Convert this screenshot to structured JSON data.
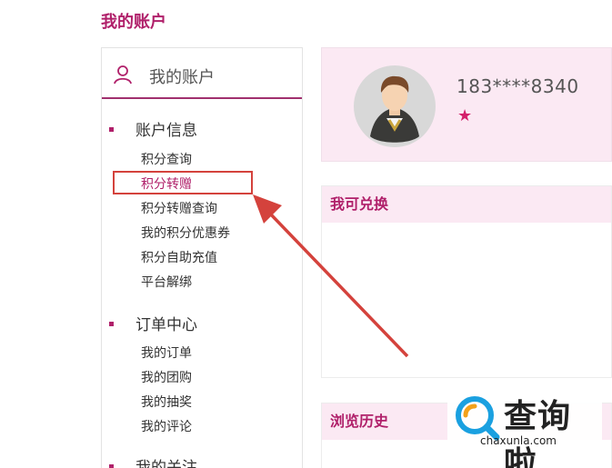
{
  "page_title": "我的账户",
  "sidebar": {
    "header_icon": "user-icon",
    "header_label": "我的账户",
    "sections": [
      {
        "title": "账户信息",
        "items": [
          "积分查询",
          "积分转赠",
          "积分转赠查询",
          "我的积分优惠券",
          "积分自助充值",
          "平台解绑"
        ]
      },
      {
        "title": "订单中心",
        "items": [
          "我的订单",
          "我的团购",
          "我的抽奖",
          "我的评论"
        ]
      },
      {
        "title": "我的关注",
        "items": []
      }
    ],
    "active_item": "积分转赠"
  },
  "profile": {
    "avatar_icon": "avatar-icon",
    "phone": "183****8340",
    "star_icon": "star-icon"
  },
  "panels": {
    "redeemable_title": "我可兑换",
    "history_title": "浏览历史"
  },
  "watermark": {
    "title": "查询啦",
    "url": "chaxunla.com"
  },
  "colors": {
    "brand": "#b0206a",
    "highlight": "#d4423c",
    "card_bg": "#fbe9f3"
  }
}
